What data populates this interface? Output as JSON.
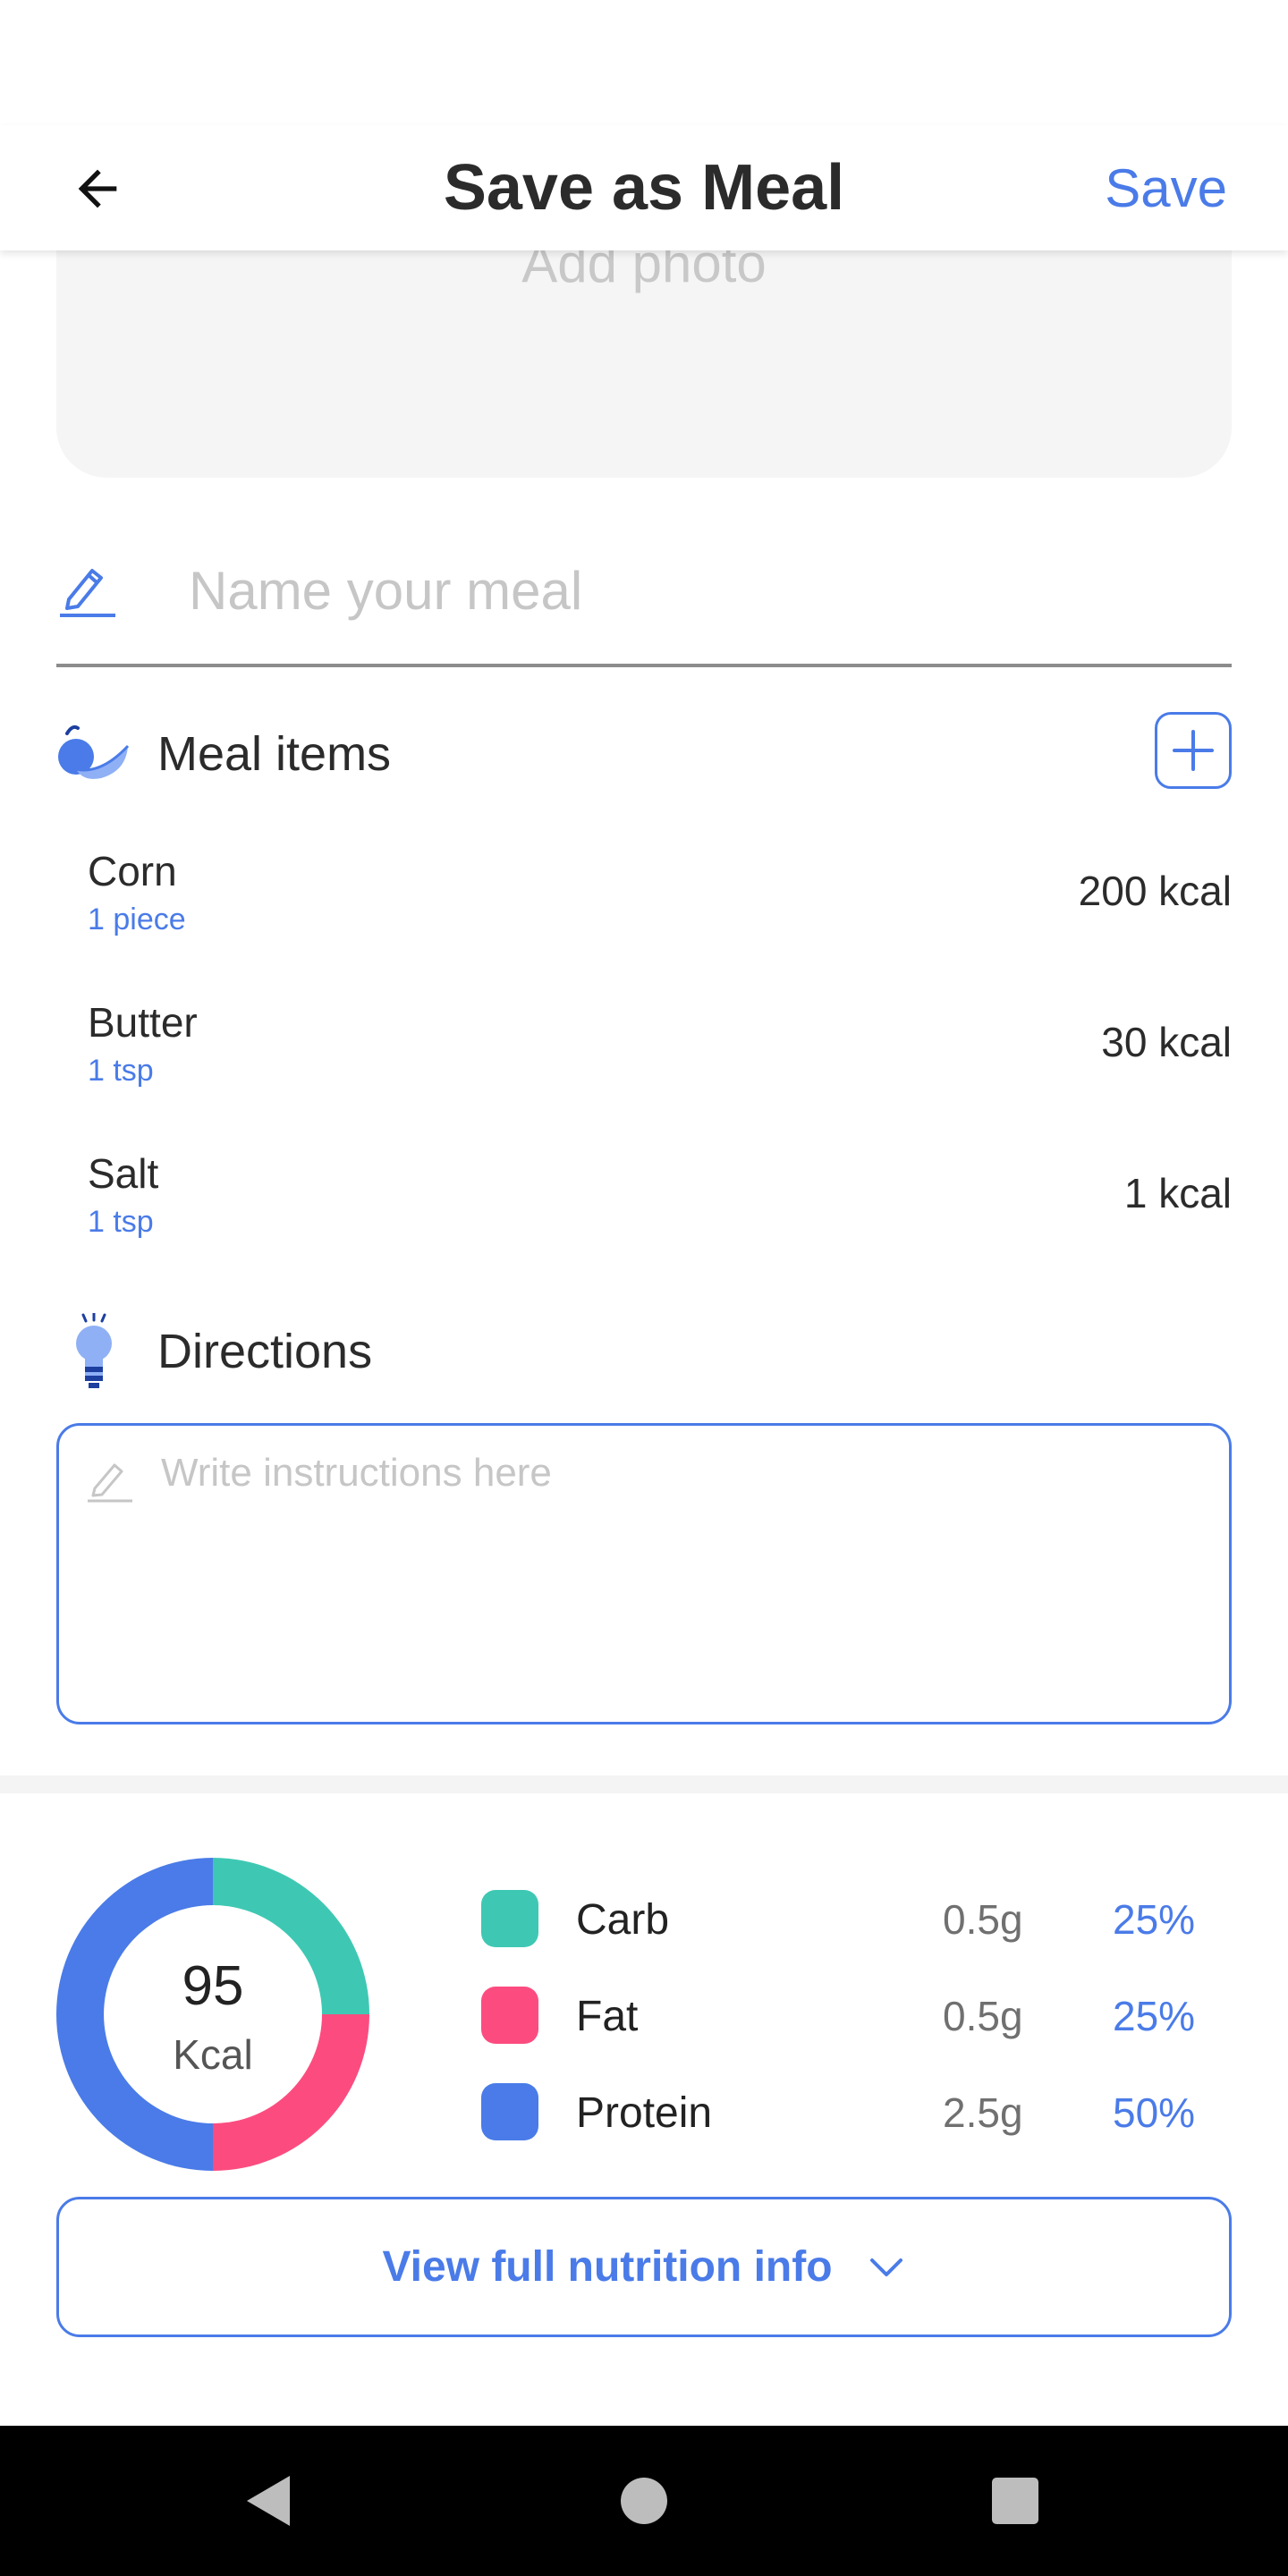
{
  "header": {
    "title": "Save as Meal",
    "save_label": "Save",
    "back_icon": "arrow-left-icon"
  },
  "photo": {
    "label": "Add photo"
  },
  "name_field": {
    "placeholder": "Name your meal",
    "value": ""
  },
  "meal_items": {
    "title": "Meal items",
    "icon": "fruit-icon",
    "add_icon": "plus-icon",
    "items": [
      {
        "name": "Corn",
        "serving": "1 piece",
        "kcal": "200 kcal"
      },
      {
        "name": "Butter",
        "serving": "1 tsp",
        "kcal": "30 kcal"
      },
      {
        "name": "Salt",
        "serving": "1 tsp",
        "kcal": "1 kcal"
      }
    ]
  },
  "directions": {
    "title": "Directions",
    "icon": "lightbulb-icon",
    "placeholder": "Write instructions here",
    "value": ""
  },
  "nutrition": {
    "kcal_value": "95",
    "kcal_unit": "Kcal",
    "macros": [
      {
        "name": "Carb",
        "grams": "0.5g",
        "percent": "25%",
        "fraction": 0.25,
        "color": "#3ec8b3"
      },
      {
        "name": "Fat",
        "grams": "0.5g",
        "percent": "25%",
        "fraction": 0.25,
        "color": "#fc4c7f"
      },
      {
        "name": "Protein",
        "grams": "2.5g",
        "percent": "50%",
        "fraction": 0.5,
        "color": "#4a7be8"
      }
    ],
    "view_button_label": "View full nutrition info"
  },
  "colors": {
    "accent": "#4a7be8",
    "carb": "#3ec8b3",
    "fat": "#fc4c7f",
    "protein": "#4a7be8"
  },
  "nav": {
    "back": "nav-back-icon",
    "home": "nav-home-icon",
    "recents": "nav-recents-icon"
  }
}
